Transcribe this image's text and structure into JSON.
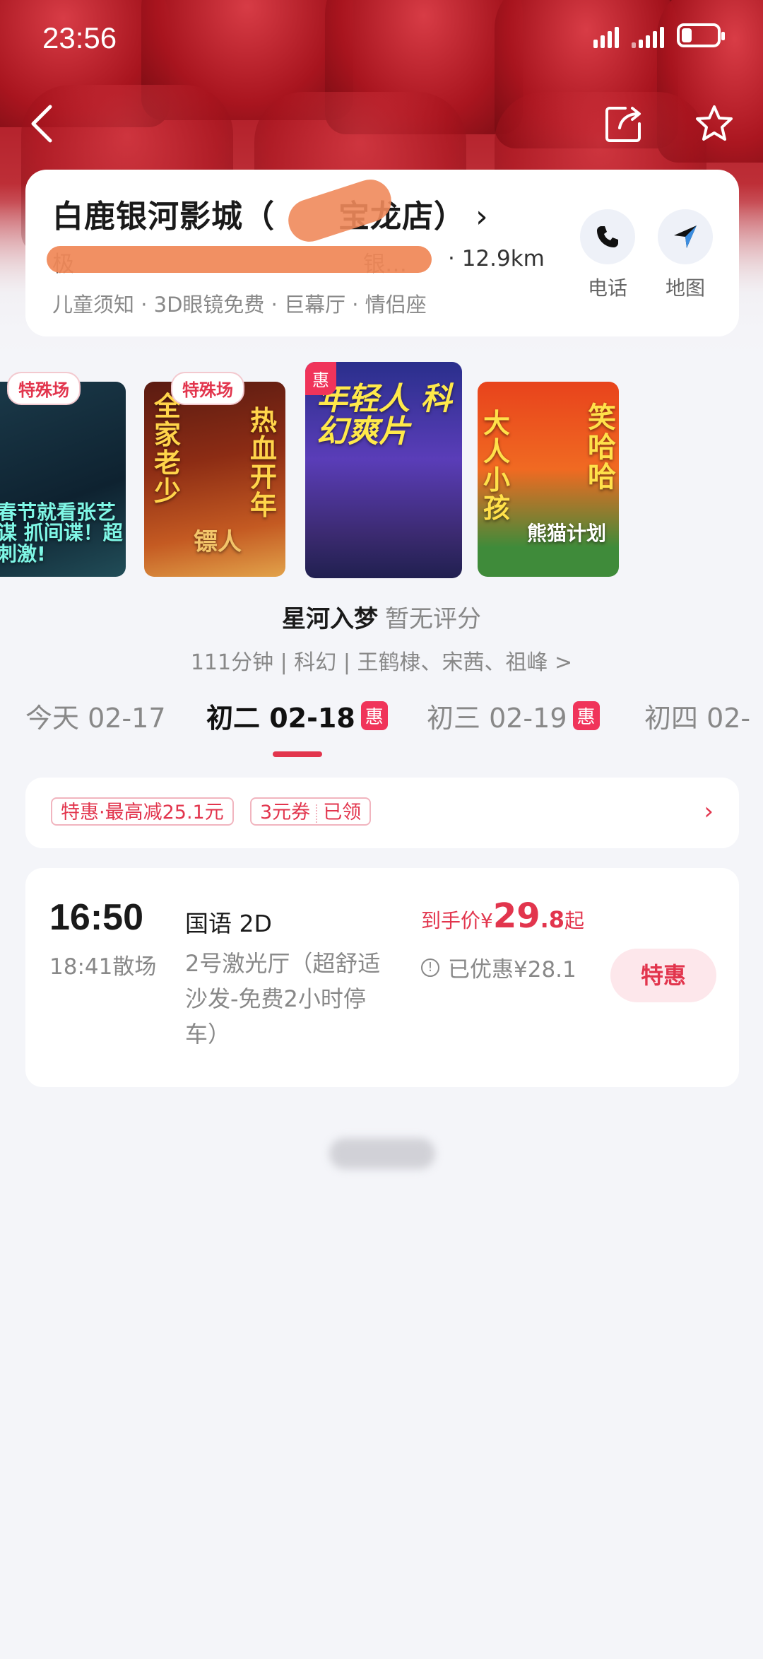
{
  "status_bar": {
    "time": "23:56"
  },
  "cinema": {
    "name": "白鹿银河影城（",
    "name_suffix": "宝龙店）",
    "address_prefix": "极",
    "address_suffix": "银…",
    "distance": "· 12.9km",
    "tags": "儿童须知 · 3D眼镜免费 · 巨幕厅 · 情侣座",
    "phone_label": "电话",
    "map_label": "地图"
  },
  "posters": [
    {
      "tag": "特殊场",
      "text": "春节就看张艺谋 抓间谍！超刺激!"
    },
    {
      "tag": "特殊场",
      "text_left": "全家老少",
      "text_right": "热血开年",
      "sub": "镖人"
    },
    {
      "tag": "惠",
      "text": "年轻人 科幻爽片"
    },
    {
      "text_left": "大人小孩",
      "text_right": "笑哈哈",
      "sub": "熊猫计划"
    }
  ],
  "movie": {
    "title": "星河入梦",
    "score": "暂无评分",
    "meta": "111分钟 | 科幻 | 王鹤棣、宋茜、祖峰 >"
  },
  "dates": [
    {
      "label": "今天 02-17",
      "badge": ""
    },
    {
      "label": "初二 02-18",
      "badge": "惠"
    },
    {
      "label": "初三 02-19",
      "badge": "惠"
    },
    {
      "label": "初四 02-",
      "badge": ""
    }
  ],
  "promo": {
    "chip1": "特惠·最高减25.1元",
    "chip2_a": "3元券",
    "chip2_b": "已领"
  },
  "showtime": {
    "start": "16:50",
    "end": "18:41散场",
    "lang": "国语 2D",
    "hall": "2号激光厅（超舒适沙发-免费2小时停车）",
    "price_label": "到手价¥",
    "price_int": "29",
    "price_dec": ".8",
    "price_suffix": "起",
    "discount": "已优惠¥28.1",
    "buy_label": "特惠"
  },
  "colors": {
    "accent": "#e2354d",
    "hui_badge": "#f0345a"
  }
}
